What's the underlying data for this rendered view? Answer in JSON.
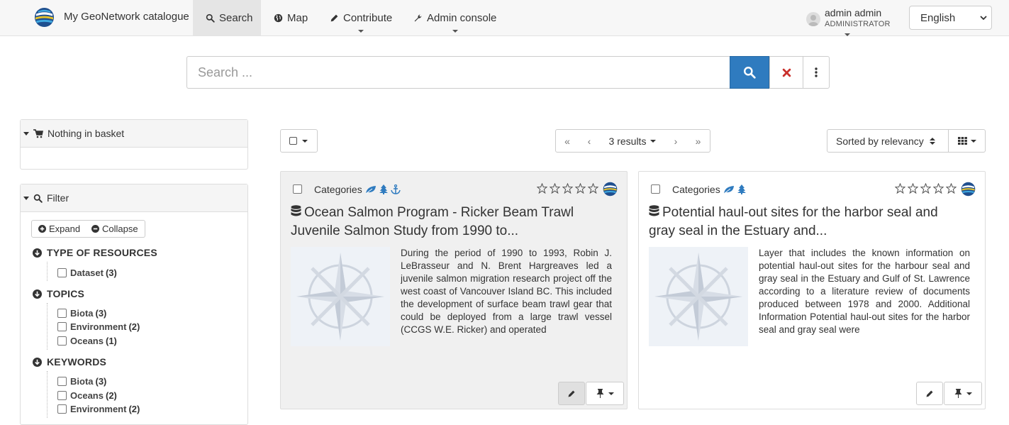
{
  "header": {
    "brand": "My GeoNetwork catalogue",
    "nav": [
      {
        "label": "Search"
      },
      {
        "label": "Map"
      },
      {
        "label": "Contribute"
      },
      {
        "label": "Admin console"
      }
    ],
    "user": {
      "name": "admin admin",
      "role": "ADMINISTRATOR"
    },
    "language": "English"
  },
  "search": {
    "placeholder": "Search ..."
  },
  "basket": {
    "title": "Nothing in basket"
  },
  "filter": {
    "title": "Filter",
    "expand_label": "Expand",
    "collapse_label": "Collapse",
    "facets": [
      {
        "title": "TYPE OF RESOURCES",
        "items": [
          {
            "label": "Dataset",
            "count": "(3)"
          }
        ]
      },
      {
        "title": "TOPICS",
        "items": [
          {
            "label": "Biota",
            "count": "(3)"
          },
          {
            "label": "Environment",
            "count": "(2)"
          },
          {
            "label": "Oceans",
            "count": "(1)"
          }
        ]
      },
      {
        "title": "KEYWORDS",
        "items": [
          {
            "label": "Biota",
            "count": "(3)"
          },
          {
            "label": "Oceans",
            "count": "(2)"
          },
          {
            "label": "Environment",
            "count": "(2)"
          }
        ]
      }
    ]
  },
  "results": {
    "count_label": "3 results",
    "sort_label": "Sorted by relevancy",
    "first": "«",
    "prev": "‹",
    "next": "›",
    "last": "»"
  },
  "records": [
    {
      "categories_label": "Categories",
      "title": "Ocean Salmon Program - Ricker Beam Trawl Juvenile Salmon Study from 1990 to...",
      "abstract": "During the period of 1990 to 1993, Robin J. LeBrasseur and N. Brent Hargreaves led a juvenile salmon migration research project off the west coast of Vancouver Island BC. This included the development of surface beam trawl gear that could be deployed from a large trawl vessel (CCGS W.E. Ricker) and operated",
      "category_icons": [
        "leaf-icon",
        "tree-icon",
        "anchor-icon"
      ],
      "background": "#f0f0f0"
    },
    {
      "categories_label": "Categories",
      "title": "Potential haul-out sites for the harbor seal and gray seal in the Estuary and...",
      "abstract": "Layer that includes the known information on potential haul-out sites for the harbour seal and gray seal in the Estuary and Gulf of St. Lawrence according to a literature review of documents produced between 1978 and 2000. Additional Information Potential haul-out sites for the harbor seal and gray seal were",
      "category_icons": [
        "leaf-icon",
        "tree-icon"
      ],
      "background": "#ffffff"
    }
  ],
  "colors": {
    "primary": "#2f7bbf",
    "danger": "#c9302c",
    "category_icon": "#2f7bbf"
  }
}
